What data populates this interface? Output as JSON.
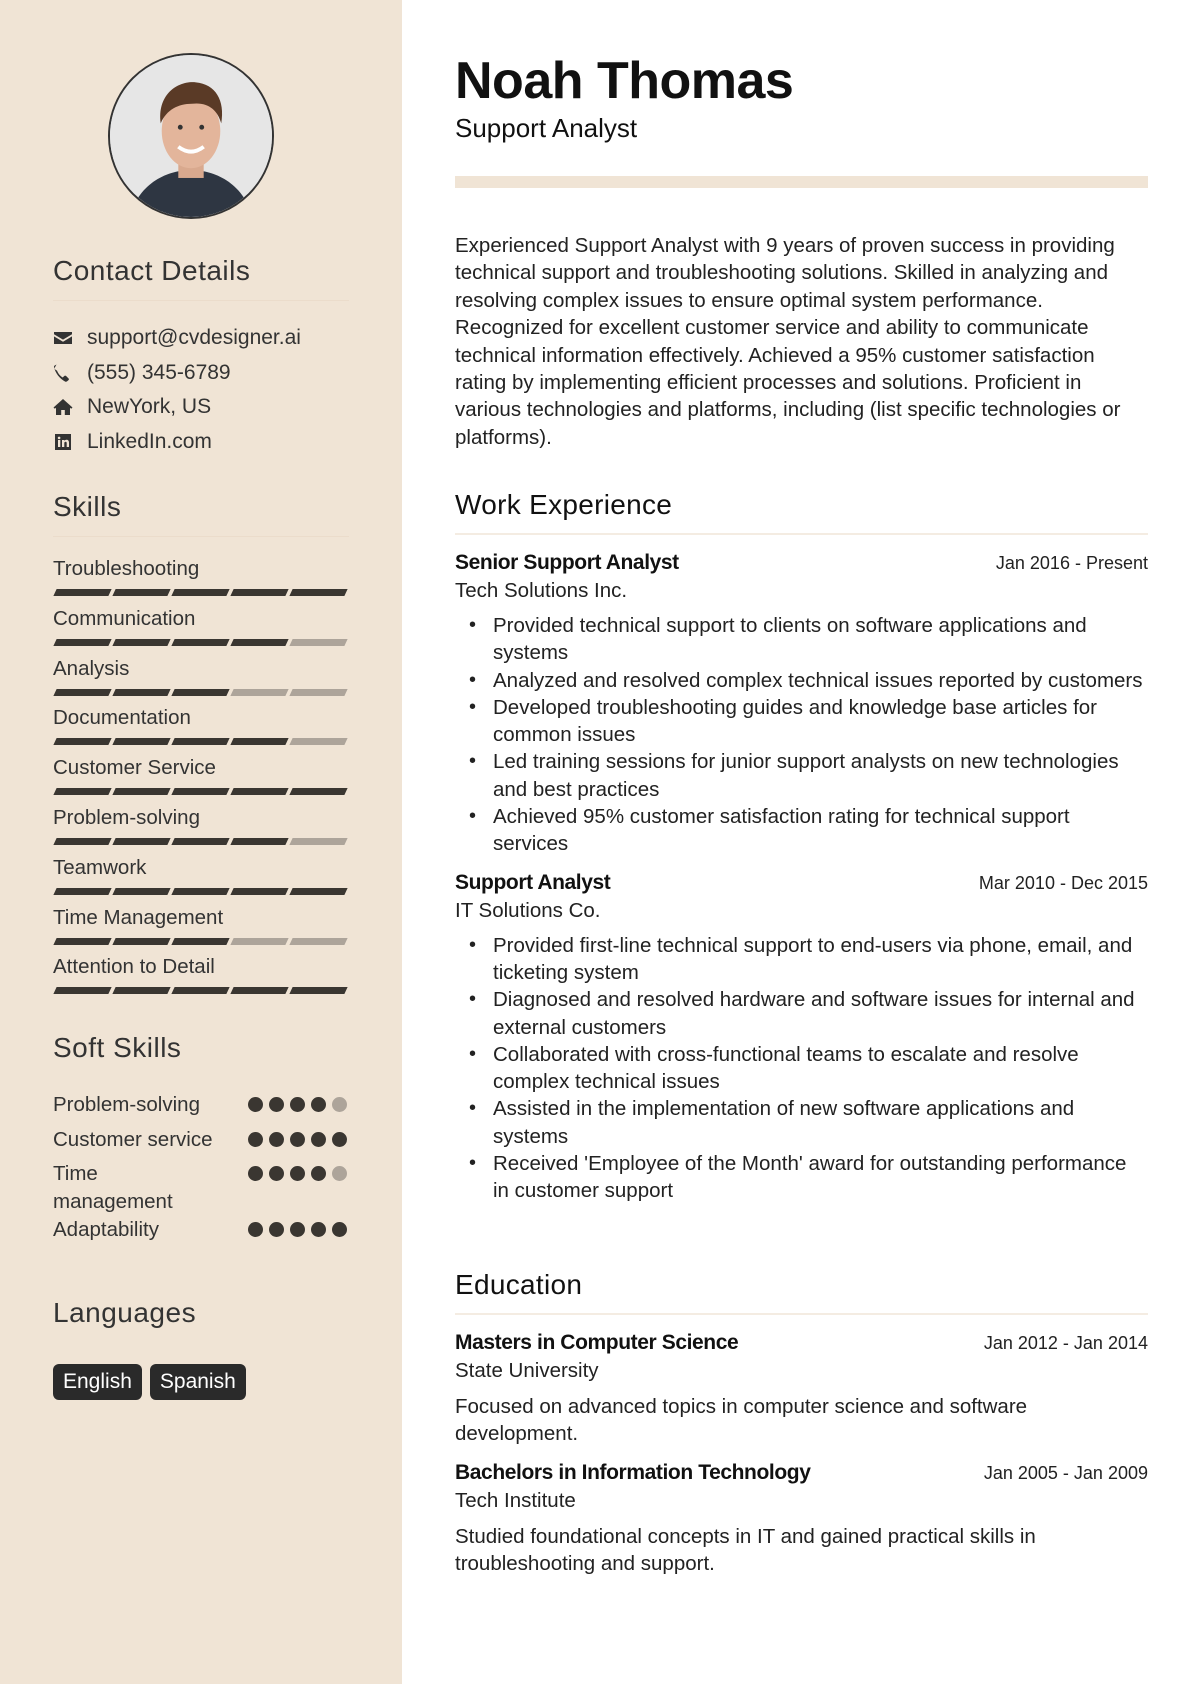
{
  "profile": {
    "name": "Noah Thomas",
    "role": "Support Analyst",
    "photo_alt": "profile-photo"
  },
  "colors": {
    "sidebar_bg": "#f0e4d5",
    "bar_on": "#3a3631",
    "bar_off": "#ada49a",
    "tag_bg": "#2a2a2a"
  },
  "contact": {
    "title": "Contact Details",
    "items": [
      {
        "icon": "envelope-icon",
        "text": "support@cvdesigner.ai"
      },
      {
        "icon": "phone-icon",
        "text": "(555) 345-6789"
      },
      {
        "icon": "home-icon",
        "text": "NewYork, US"
      },
      {
        "icon": "linkedin-icon",
        "text": "LinkedIn.com"
      }
    ]
  },
  "skills": {
    "title": "Skills",
    "max": 5,
    "items": [
      {
        "name": "Troubleshooting",
        "level": 5
      },
      {
        "name": "Communication",
        "level": 4
      },
      {
        "name": "Analysis",
        "level": 3
      },
      {
        "name": "Documentation",
        "level": 4
      },
      {
        "name": "Customer Service",
        "level": 5
      },
      {
        "name": "Problem-solving",
        "level": 4
      },
      {
        "name": "Teamwork",
        "level": 5
      },
      {
        "name": "Time Management",
        "level": 3
      },
      {
        "name": "Attention to Detail",
        "level": 5
      }
    ]
  },
  "soft_skills": {
    "title": "Soft Skills",
    "max": 5,
    "items": [
      {
        "name": "Problem-solving",
        "level": 4
      },
      {
        "name": "Customer service",
        "level": 5
      },
      {
        "name": "Time management",
        "level": 4
      },
      {
        "name": "Adaptability",
        "level": 5
      }
    ]
  },
  "languages": {
    "title": "Languages",
    "items": [
      "English",
      "Spanish"
    ]
  },
  "summary": "Experienced Support Analyst with 9 years of proven success in providing technical support and troubleshooting solutions. Skilled in analyzing and resolving complex issues to ensure optimal system performance. Recognized for excellent customer service and ability to communicate technical information effectively. Achieved a 95% customer satisfaction rating by implementing efficient processes and solutions. Proficient in various technologies and platforms, including (list specific technologies or platforms).",
  "work": {
    "title": "Work Experience",
    "jobs": [
      {
        "title": "Senior Support Analyst",
        "company": "Tech Solutions Inc.",
        "dates": "Jan 2016 - Present",
        "bullets": [
          "Provided technical support to clients on software applications and systems",
          "Analyzed and resolved complex technical issues reported by customers",
          "Developed troubleshooting guides and knowledge base articles for common issues",
          "Led training sessions for junior support analysts on new technologies and best practices",
          "Achieved 95% customer satisfaction rating for technical support services"
        ]
      },
      {
        "title": "Support Analyst",
        "company": "IT Solutions Co.",
        "dates": "Mar 2010 - Dec 2015",
        "bullets": [
          "Provided first-line technical support to end-users via phone, email, and ticketing system",
          "Diagnosed and resolved hardware and software issues for internal and external customers",
          "Collaborated with cross-functional teams to escalate and resolve complex technical issues",
          "Assisted in the implementation of new software applications and systems",
          "Received 'Employee of the Month' award for outstanding performance in customer support"
        ]
      }
    ]
  },
  "education": {
    "title": "Education",
    "entries": [
      {
        "degree": "Masters in Computer Science",
        "school": "State University",
        "dates": "Jan 2012 - Jan 2014",
        "description": "Focused on advanced topics in computer science and software development."
      },
      {
        "degree": "Bachelors in Information Technology",
        "school": "Tech Institute",
        "dates": "Jan 2005 - Jan 2009",
        "description": "Studied foundational concepts in IT and gained practical skills in troubleshooting and support."
      }
    ]
  }
}
